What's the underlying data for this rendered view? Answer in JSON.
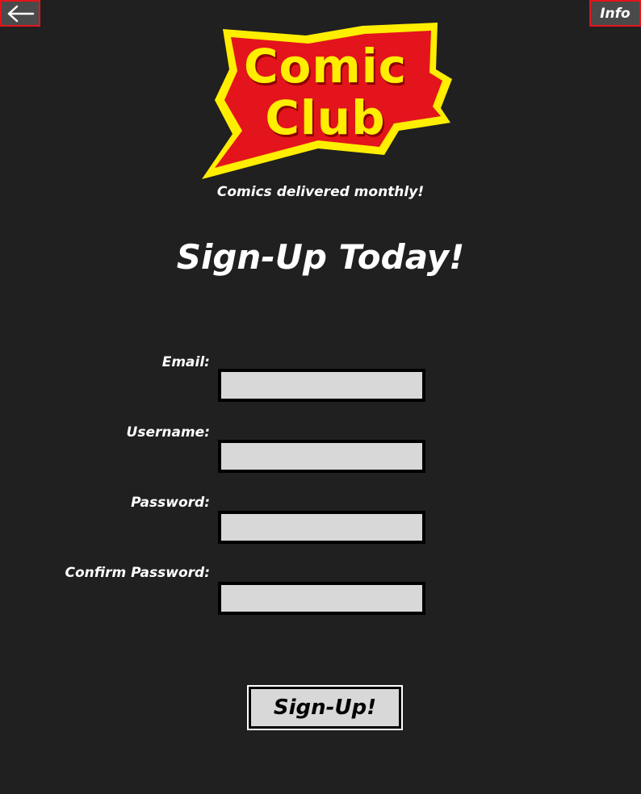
{
  "nav": {
    "back_icon": "arrow-left-icon",
    "info_label": "Info"
  },
  "logo": {
    "line1": "Comic",
    "line2": "Club",
    "colors": {
      "fill": "#e3141b",
      "border": "#ffee00",
      "text": "#ffee00"
    }
  },
  "tagline": "Comics delivered monthly!",
  "title": "Sign-Up Today!",
  "form": {
    "fields": [
      {
        "label": "Email:",
        "value": ""
      },
      {
        "label": "Username:",
        "value": ""
      },
      {
        "label": "Password:",
        "value": ""
      },
      {
        "label": "Confirm Password:",
        "value": ""
      }
    ],
    "submit_label": "Sign-Up!"
  },
  "colors": {
    "background": "#202020",
    "accent": "#e3141b",
    "input_bg": "#d8d8d8"
  }
}
